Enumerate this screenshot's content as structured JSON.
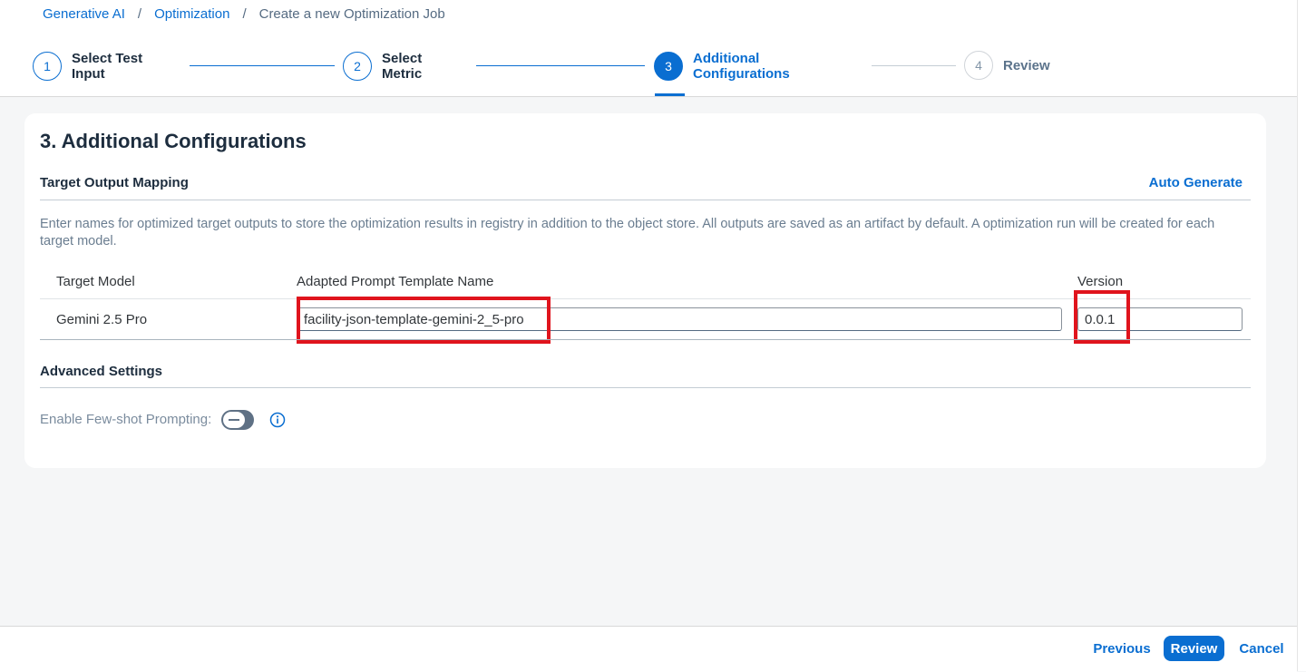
{
  "breadcrumb": {
    "items": [
      "Generative AI",
      "Optimization"
    ],
    "separator": "/",
    "current": "Create a new Optimization Job"
  },
  "wizard": {
    "steps": [
      {
        "number": "1",
        "line1": "Select Test",
        "line2": "Input",
        "state": "done"
      },
      {
        "number": "2",
        "line1": "Select",
        "line2": "Metric",
        "state": "done"
      },
      {
        "number": "3",
        "line1": "Additional",
        "line2": "Configurations",
        "state": "active"
      },
      {
        "number": "4",
        "line1": "Review",
        "line2": "",
        "state": "inactive"
      }
    ]
  },
  "card": {
    "title": "3. Additional Configurations",
    "target_mapping": {
      "title": "Target Output Mapping",
      "auto_generate": "Auto Generate",
      "description": "Enter names for optimized target outputs to store the optimization results in registry in addition to the object store. All outputs are saved as an artifact by default. A optimization run will be created for each target model.",
      "columns": {
        "model": "Target Model",
        "template": "Adapted Prompt Template Name",
        "version": "Version"
      },
      "rows": [
        {
          "model": "Gemini 2.5 Pro",
          "template": "facility-json-template-gemini-2_5-pro",
          "version": "0.0.1"
        }
      ]
    },
    "advanced": {
      "title": "Advanced Settings",
      "few_shot_label": "Enable Few-shot Prompting:",
      "few_shot_enabled": false
    }
  },
  "footer": {
    "previous": "Previous",
    "review": "Review",
    "cancel": "Cancel"
  },
  "colors": {
    "accent": "#0a6ed1",
    "highlight": "#e0141d"
  }
}
